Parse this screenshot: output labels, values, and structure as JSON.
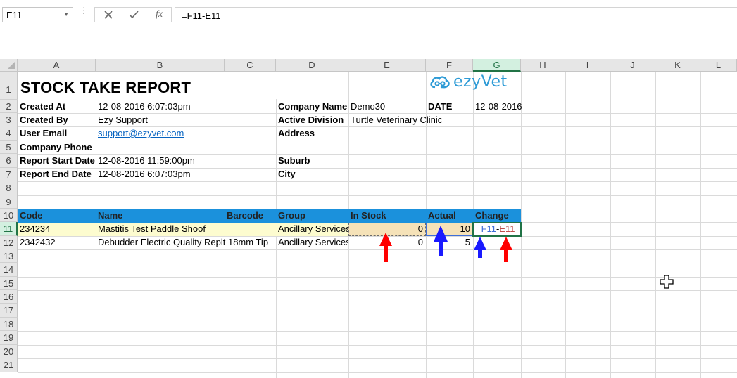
{
  "formula_bar": {
    "name_box": "E11",
    "formula": "=F11-E11",
    "fx_label": "fx"
  },
  "columns": [
    "A",
    "B",
    "C",
    "D",
    "E",
    "F",
    "G",
    "H",
    "I",
    "J",
    "K",
    "L"
  ],
  "rows": [
    "1",
    "2",
    "3",
    "4",
    "5",
    "6",
    "7",
    "8",
    "9",
    "10",
    "11",
    "12",
    "13",
    "14",
    "15",
    "16",
    "17",
    "18",
    "19",
    "20",
    "21"
  ],
  "report": {
    "title": "STOCK TAKE REPORT",
    "created_at_label": "Created At",
    "created_at_value": "12-08-2016 6:07:03pm",
    "created_by_label": "Created By",
    "created_by_value": "Ezy Support",
    "user_email_label": "User Email",
    "user_email_value": "support@ezyvet.com",
    "company_phone_label": "Company Phone",
    "report_start_label": "Report Start Date",
    "report_start_value": "12-08-2016 11:59:00pm",
    "report_end_label": "Report End Date",
    "report_end_value": "12-08-2016 6:07:03pm",
    "company_name_label": "Company Name",
    "company_name_value": "Demo30",
    "date_label": "DATE",
    "date_value": "12-08-2016",
    "active_division_label": "Active Division",
    "active_division_value": "Turtle Veterinary Clinic",
    "address_label": "Address",
    "suburb_label": "Suburb",
    "city_label": "City",
    "logo_text": "ezyVet"
  },
  "table": {
    "headers": {
      "code": "Code",
      "name": "Name",
      "barcode": "Barcode",
      "group": "Group",
      "in_stock": "In Stock",
      "actual": "Actual",
      "change": "Change"
    },
    "rows": [
      {
        "code": "234234",
        "name": "Mastitis Test Paddle Shoof",
        "group": "Ancillary Services",
        "in_stock": "0",
        "actual": "10",
        "change": "=F11-E11",
        "change_part1": "=",
        "change_part2": "F11",
        "change_part3": "-",
        "change_part4": "E11"
      },
      {
        "code": "2342432",
        "name": "Debudder Electric Quality Replt 18mm Tip",
        "group": "Ancillary Services",
        "in_stock": "0",
        "actual": "5"
      }
    ]
  },
  "colors": {
    "header_band": "#1b91dc",
    "selected_row_fill": "#fdfccf",
    "red_arrow": "#ff0000",
    "blue_arrow": "#1a1aff",
    "accent_green": "#217346"
  }
}
